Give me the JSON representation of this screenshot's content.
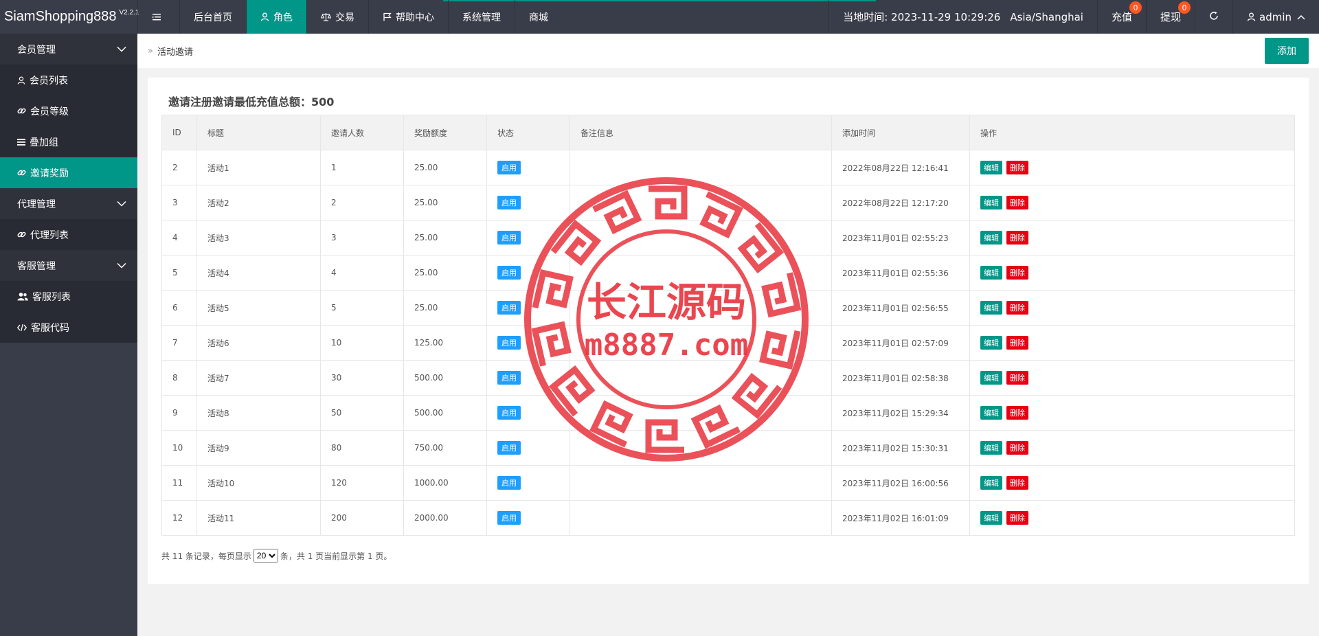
{
  "app": {
    "logo_text": "SiamShopping888",
    "version": "V2.2.1"
  },
  "topnav": {
    "items": [
      {
        "label": "后台首页",
        "icon": "none",
        "active": false
      },
      {
        "label": "角色",
        "icon": "user-icon",
        "active": true
      },
      {
        "label": "交易",
        "icon": "scale-icon",
        "active": false
      },
      {
        "label": "帮助中心",
        "icon": "flag-icon",
        "active": false
      },
      {
        "label": "系统管理",
        "icon": "none",
        "active": false
      },
      {
        "label": "商城",
        "icon": "none",
        "active": false
      }
    ],
    "time_label": "当地时间: 2023-11-29 10:29:26",
    "timezone": "Asia/Shanghai",
    "recharge_label": "充值",
    "recharge_badge": "0",
    "withdraw_label": "提现",
    "withdraw_badge": "0",
    "user_label": "admin"
  },
  "sidebar": {
    "groups": [
      {
        "label": "会员管理",
        "items": [
          {
            "label": "会员列表",
            "icon": "user-icon",
            "active": false
          },
          {
            "label": "会员等级",
            "icon": "link-icon",
            "active": false
          },
          {
            "label": "叠加组",
            "icon": "list-icon",
            "active": false
          },
          {
            "label": "邀请奖励",
            "icon": "link-icon",
            "active": true
          }
        ]
      },
      {
        "label": "代理管理",
        "items": [
          {
            "label": "代理列表",
            "icon": "link-icon",
            "active": false
          }
        ]
      },
      {
        "label": "客服管理",
        "items": [
          {
            "label": "客服列表",
            "icon": "users-icon",
            "active": false
          },
          {
            "label": "客服代码",
            "icon": "code-icon",
            "active": false
          }
        ]
      }
    ]
  },
  "breadcrumb": {
    "current": "活动邀请"
  },
  "toolbar": {
    "add_label": "添加"
  },
  "card": {
    "title": "邀请注册邀请最低充值总额：500"
  },
  "table": {
    "headers": [
      "ID",
      "标题",
      "邀请人数",
      "奖励额度",
      "状态",
      "备注信息",
      "添加时间",
      "操作"
    ],
    "status_label": "启用",
    "edit_label": "编辑",
    "delete_label": "删除",
    "rows": [
      {
        "id": "2",
        "title": "活动1",
        "count": "1",
        "amount": "25.00",
        "note": "",
        "time": "2022年08月22日 12:16:41"
      },
      {
        "id": "3",
        "title": "活动2",
        "count": "2",
        "amount": "25.00",
        "note": "",
        "time": "2022年08月22日 12:17:20"
      },
      {
        "id": "4",
        "title": "活动3",
        "count": "3",
        "amount": "25.00",
        "note": "",
        "time": "2023年11月01日 02:55:23"
      },
      {
        "id": "5",
        "title": "活动4",
        "count": "4",
        "amount": "25.00",
        "note": "",
        "time": "2023年11月01日 02:55:36"
      },
      {
        "id": "6",
        "title": "活动5",
        "count": "5",
        "amount": "25.00",
        "note": "",
        "time": "2023年11月01日 02:56:55"
      },
      {
        "id": "7",
        "title": "活动6",
        "count": "10",
        "amount": "125.00",
        "note": "",
        "time": "2023年11月01日 02:57:09"
      },
      {
        "id": "8",
        "title": "活动7",
        "count": "30",
        "amount": "500.00",
        "note": "",
        "time": "2023年11月01日 02:58:38"
      },
      {
        "id": "9",
        "title": "活动8",
        "count": "50",
        "amount": "500.00",
        "note": "",
        "time": "2023年11月02日 15:29:34"
      },
      {
        "id": "10",
        "title": "活动9",
        "count": "80",
        "amount": "750.00",
        "note": "",
        "time": "2023年11月02日 15:30:31"
      },
      {
        "id": "11",
        "title": "活动10",
        "count": "120",
        "amount": "1000.00",
        "note": "",
        "time": "2023年11月02日 16:00:56"
      },
      {
        "id": "12",
        "title": "活动11",
        "count": "200",
        "amount": "2000.00",
        "note": "",
        "time": "2023年11月02日 16:01:09"
      }
    ]
  },
  "pager": {
    "prefix": "共 11 条记录，每页显示",
    "page_size": "20",
    "suffix": "条，共 1 页当前显示第 1 页。"
  },
  "watermark": {
    "line1": "长江源码",
    "line2": "m8887.com",
    "color": "#e8323c"
  }
}
